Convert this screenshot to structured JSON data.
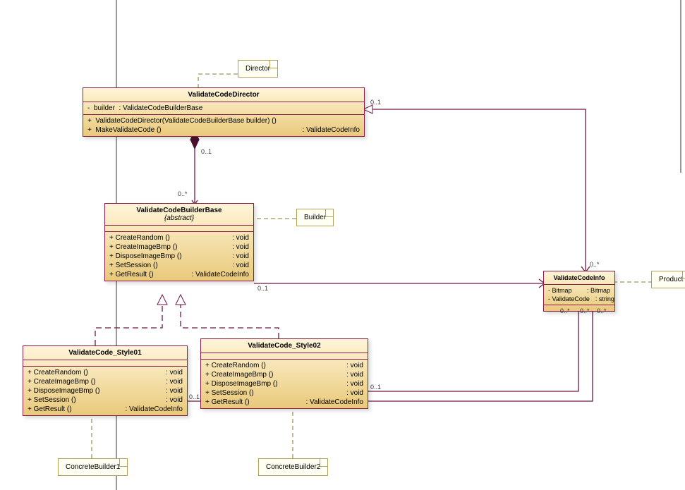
{
  "notes": {
    "director": "Director",
    "builder": "Builder",
    "concrete1": "ConcreteBuilder1",
    "concrete2": "ConcreteBuilder2",
    "product": "Product"
  },
  "classes": {
    "director": {
      "name": "ValidateCodeDirector",
      "attr1_vis": "-",
      "attr1_name": "builder",
      "attr1_type": ": ValidateCodeBuilderBase",
      "op1_vis": "+",
      "op1_name": "ValidateCodeDirector(ValidateCodeBuilderBase builder) ()",
      "op1_ret": "",
      "op2_vis": "+",
      "op2_name": "MakeValidateCode ()",
      "op2_ret": ": ValidateCodeInfo"
    },
    "builderBase": {
      "name": "ValidateCodeBuilderBase",
      "stereo": "{abstract}",
      "ops": [
        {
          "v": "+",
          "n": "CreateRandom ()",
          "r": ": void"
        },
        {
          "v": "+",
          "n": "CreateImageBmp ()",
          "r": ": void"
        },
        {
          "v": "+",
          "n": "DisposeImageBmp ()",
          "r": ": void"
        },
        {
          "v": "+",
          "n": "SetSession ()",
          "r": ": void"
        },
        {
          "v": "+",
          "n": "GetResult ()",
          "r": ": ValidateCodeInfo"
        }
      ]
    },
    "style01": {
      "name": "ValidateCode_Style01",
      "ops": [
        {
          "v": "+",
          "n": "CreateRandom ()",
          "r": ": void"
        },
        {
          "v": "+",
          "n": "CreateImageBmp ()",
          "r": ": void"
        },
        {
          "v": "+",
          "n": "DisposeImageBmp ()",
          "r": ": void"
        },
        {
          "v": "+",
          "n": "SetSession ()",
          "r": ": void"
        },
        {
          "v": "+",
          "n": "GetResult ()",
          "r": ": ValidateCodeInfo"
        }
      ]
    },
    "style02": {
      "name": "ValidateCode_Style02",
      "ops": [
        {
          "v": "+",
          "n": "CreateRandom ()",
          "r": ": void"
        },
        {
          "v": "+",
          "n": "CreateImageBmp ()",
          "r": ": void"
        },
        {
          "v": "+",
          "n": "DisposeImageBmp ()",
          "r": ": void"
        },
        {
          "v": "+",
          "n": "SetSession ()",
          "r": ": void"
        },
        {
          "v": "+",
          "n": "GetResult ()",
          "r": ": ValidateCodeInfo"
        }
      ]
    },
    "info": {
      "name": "ValidateCodeInfo",
      "attrs": [
        {
          "v": "-",
          "n": "Bitmap",
          "r": ": Bitmap"
        },
        {
          "v": "-",
          "n": "ValidateCode",
          "r": ": string"
        }
      ]
    }
  },
  "mult": {
    "dir_comp_top": "0..1",
    "dir_comp_bot": "0..*",
    "dir_info_left": "0..1",
    "dir_info_right": "0..*",
    "base_info_left": "0..1",
    "style01_info_left": "0..1",
    "style02_info_left": "0..1",
    "info_r1": "0..*",
    "info_r2": "0..*",
    "info_r3": "0..*"
  }
}
